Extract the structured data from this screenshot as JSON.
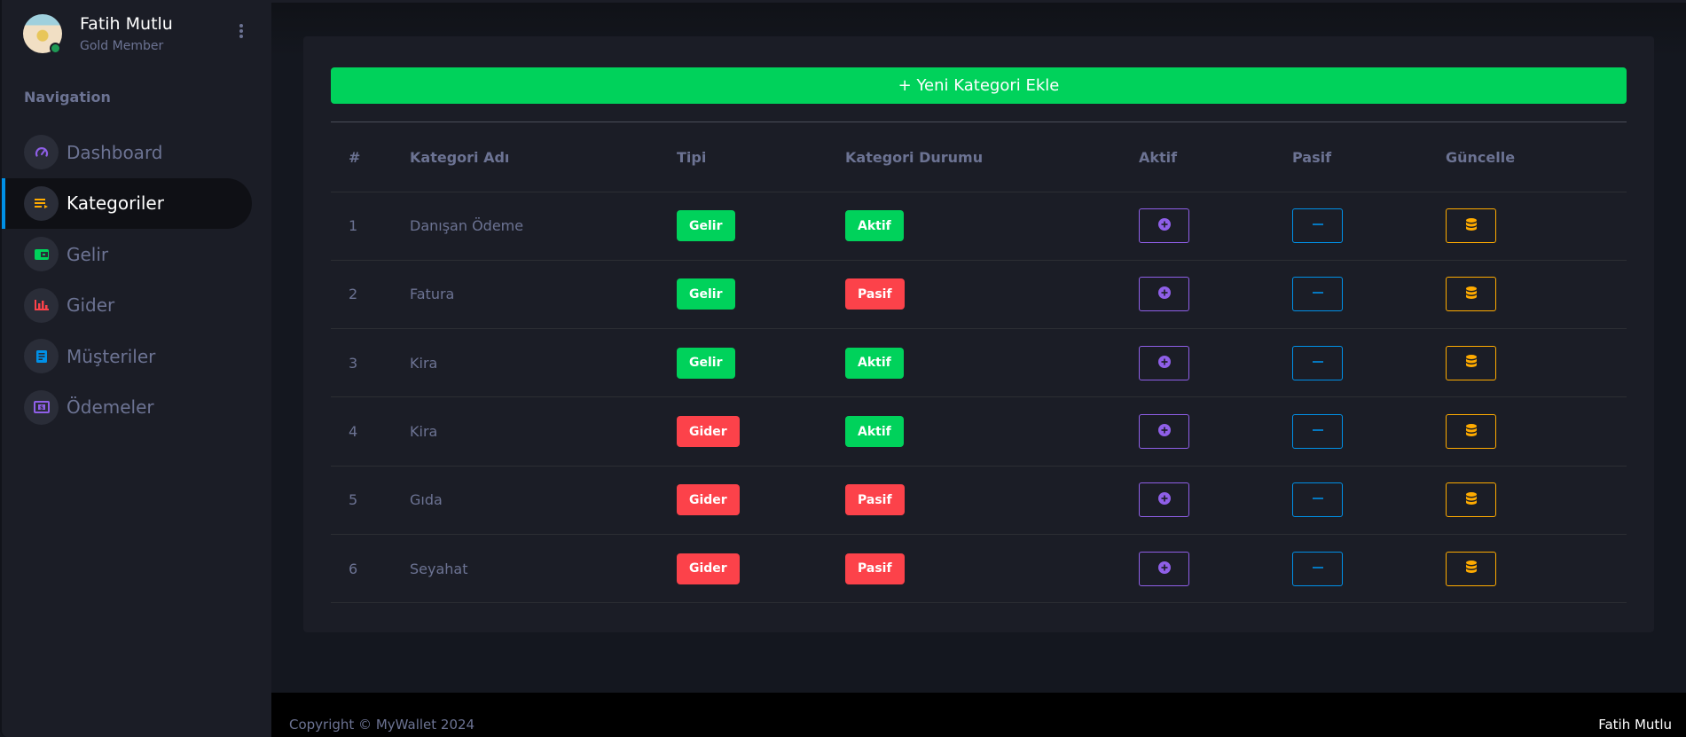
{
  "profile": {
    "name": "Fatih Mutlu",
    "role": "Gold Member",
    "status": "online"
  },
  "sidebar": {
    "title": "Navigation",
    "items": [
      {
        "label": "Dashboard",
        "icon": "speedometer-icon",
        "color": "#8f5fe8",
        "active": false
      },
      {
        "label": "Kategoriler",
        "icon": "playlist-play-icon",
        "color": "#ffab00",
        "active": true
      },
      {
        "label": "Gelir",
        "icon": "wallet-icon",
        "color": "#00d25b",
        "active": false
      },
      {
        "label": "Gider",
        "icon": "chart-bar-icon",
        "color": "#fc424a",
        "active": false
      },
      {
        "label": "Müşteriler",
        "icon": "document-icon",
        "color": "#0090e7",
        "active": false
      },
      {
        "label": "Ödemeler",
        "icon": "cash-icon",
        "color": "#8f5fe8",
        "active": false
      }
    ]
  },
  "main": {
    "add_button_label": "+ Yeni Kategori Ekle",
    "table": {
      "columns": [
        "#",
        "Kategori Adı",
        "Tipi",
        "Kategori Durumu",
        "Aktif",
        "Pasif",
        "Güncelle"
      ],
      "rows": [
        {
          "no": "1",
          "name": "Danışan Ödeme",
          "type": "Gelir",
          "status": "Aktif"
        },
        {
          "no": "2",
          "name": "Fatura",
          "type": "Gelir",
          "status": "Pasif"
        },
        {
          "no": "3",
          "name": "Kira",
          "type": "Gelir",
          "status": "Aktif"
        },
        {
          "no": "4",
          "name": "Kira",
          "type": "Gider",
          "status": "Aktif"
        },
        {
          "no": "5",
          "name": "Gıda",
          "type": "Gider",
          "status": "Pasif"
        },
        {
          "no": "6",
          "name": "Seyahat",
          "type": "Gider",
          "status": "Pasif"
        }
      ]
    }
  },
  "colors": {
    "success": "#00d25b",
    "danger": "#fc424a",
    "primary": "#0090e7",
    "purple": "#8f5fe8",
    "warning": "#ffab00"
  },
  "footer": {
    "copyright": "Copyright © MyWallet 2024",
    "user": "Fatih Mutlu"
  }
}
